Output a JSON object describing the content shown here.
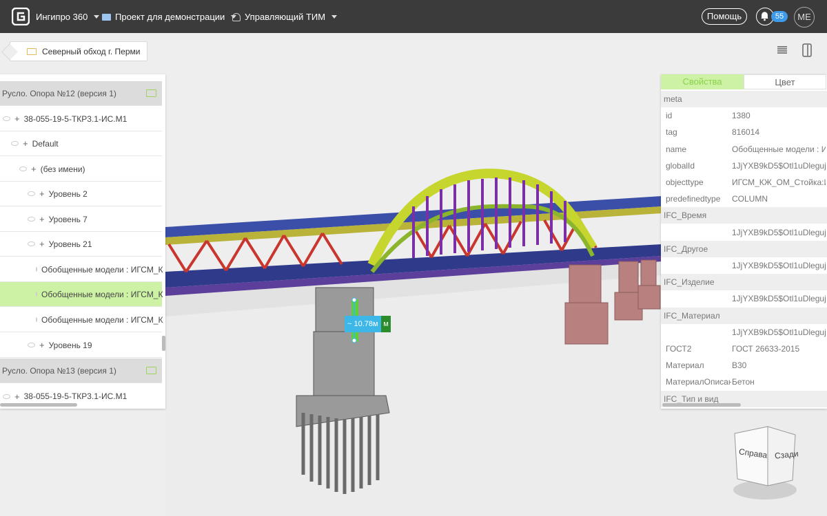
{
  "app": {
    "name": "Ингипро 360"
  },
  "topbar": {
    "project_label": "Проект для демонстрации",
    "role_label": "Управляющий ТИМ",
    "help_label": "Помощь",
    "notifications_count": "55",
    "user_initials": "ME"
  },
  "breadcrumb": {
    "label": "Северный обход г. Перми"
  },
  "tree": {
    "rows": [
      {
        "label": "Русло. Опора №12 (версия 1)",
        "type": "group"
      },
      {
        "label": "38-055-19-5-ТКР3.1-ИС.М1",
        "type": "node"
      },
      {
        "label": "Default",
        "type": "node"
      },
      {
        "label": "(без имени)",
        "type": "node"
      },
      {
        "label": "Уровень 2",
        "type": "node"
      },
      {
        "label": "Уровень 7",
        "type": "node"
      },
      {
        "label": "Уровень 21",
        "type": "node"
      },
      {
        "label": "Обобщенные модели : ИГСМ_К",
        "type": "leaf"
      },
      {
        "label": "Обобщенные модели : ИГСМ_К",
        "type": "leaf-selected"
      },
      {
        "label": "Обобщенные модели : ИГСМ_К",
        "type": "leaf"
      },
      {
        "label": "Уровень 19",
        "type": "node"
      },
      {
        "label": "Русло. Опора №13 (версия 1)",
        "type": "group"
      },
      {
        "label": "38-055-19-5-ТКР3.1-ИС.М1",
        "type": "node"
      }
    ]
  },
  "properties": {
    "tab_properties": "Свойства",
    "tab_color": "Цвет",
    "rows": [
      {
        "key": "meta",
        "value": "",
        "section": true
      },
      {
        "key": "id",
        "value": "1380"
      },
      {
        "key": "tag",
        "value": "816014"
      },
      {
        "key": "name",
        "value": "Обобщенные модели : И"
      },
      {
        "key": "globalId",
        "value": "1JjYXB9kD5$Otl1uDleguj"
      },
      {
        "key": "objecttype",
        "value": "ИГСМ_КЖ_ОМ_Стойка:ИГ"
      },
      {
        "key": "predefinedtype",
        "value": "COLUMN"
      },
      {
        "key": "IFC_Время",
        "value": "",
        "section": true
      },
      {
        "key": "",
        "value": "1JjYXB9kD5$Otl1uDleguj"
      },
      {
        "key": "IFC_Другое",
        "value": "",
        "section": true
      },
      {
        "key": "",
        "value": "1JjYXB9kD5$Otl1uDleguj"
      },
      {
        "key": "IFC_Изделие",
        "value": "",
        "section": true
      },
      {
        "key": "",
        "value": "1JjYXB9kD5$Otl1uDleguj"
      },
      {
        "key": "IFC_Материал",
        "value": "",
        "section": true
      },
      {
        "key": "",
        "value": "1JjYXB9kD5$Otl1uDleguj"
      },
      {
        "key": "ГОСТ2",
        "value": "ГОСТ 26633-2015"
      },
      {
        "key": "Материал",
        "value": "B30"
      },
      {
        "key": "МатериалОписан",
        "value": "Бетон"
      },
      {
        "key": "IFC_Тип и вид",
        "value": "",
        "section": true
      }
    ]
  },
  "measurement": {
    "label": "~ 10.78м",
    "tail": "м"
  },
  "viewcube": {
    "face_right": "Справа",
    "face_back": "Сзади"
  },
  "colors": {
    "accent_green": "#cdf2a6",
    "topbar": "#3b3b3b",
    "measure_blue": "#3db6e8"
  }
}
